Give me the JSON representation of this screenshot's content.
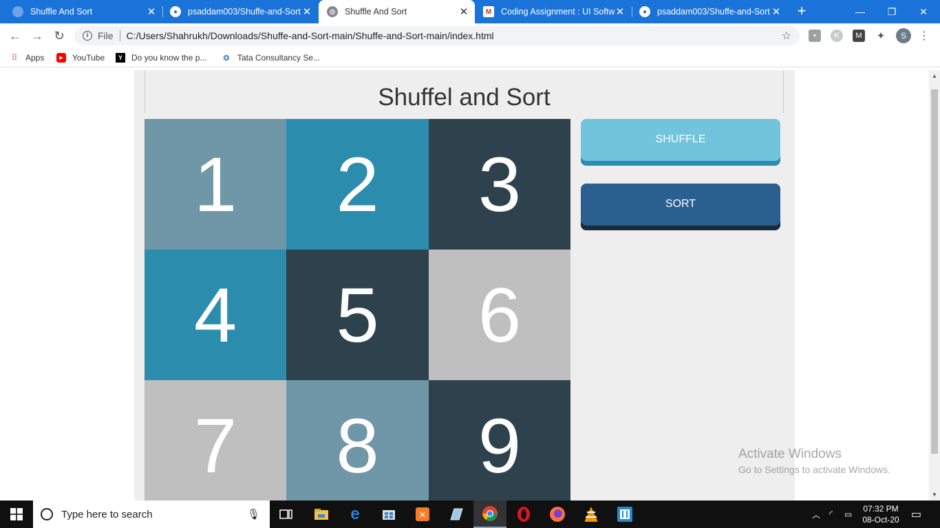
{
  "browser": {
    "tabs": [
      {
        "title": "Shuffle And Sort",
        "icon": "globe-icon",
        "active": false
      },
      {
        "title": "psaddam003/Shuffe-and-Sort",
        "icon": "github-icon",
        "active": false
      },
      {
        "title": "Shuffle And Sort",
        "icon": "globe-icon",
        "active": true
      },
      {
        "title": "Coding Assignment : UI Softwa",
        "icon": "gmail-icon",
        "active": false
      },
      {
        "title": "psaddam003/Shuffe-and-Sort",
        "icon": "github-icon",
        "active": false
      }
    ],
    "omnibox": {
      "scheme_label": "File",
      "url": "C:/Users/Shahrukh/Downloads/Shuffe-and-Sort-main/Shuffe-and-Sort-main/index.html"
    },
    "profile_initial": "S",
    "bookmarks": [
      {
        "label": "Apps",
        "icon": "apps-grid-icon"
      },
      {
        "label": "YouTube",
        "icon": "youtube-icon"
      },
      {
        "label": "Do you know the p...",
        "icon": "y-combinator-icon"
      },
      {
        "label": "Tata Consultancy Se...",
        "icon": "tata-icon"
      }
    ]
  },
  "page": {
    "title": "Shuffel and Sort",
    "tiles": [
      {
        "number": "1",
        "color": "#6f97a8"
      },
      {
        "number": "2",
        "color": "#2b8cad"
      },
      {
        "number": "3",
        "color": "#2e424d"
      },
      {
        "number": "4",
        "color": "#2b8cad"
      },
      {
        "number": "5",
        "color": "#2e424d"
      },
      {
        "number": "6",
        "color": "#bfbfbf"
      },
      {
        "number": "7",
        "color": "#bfbfbf"
      },
      {
        "number": "8",
        "color": "#6f97a8"
      },
      {
        "number": "9",
        "color": "#2e424d"
      }
    ],
    "buttons": {
      "shuffle_label": "SHUFFLE",
      "sort_label": "SORT"
    }
  },
  "watermark": {
    "line1": "Activate Windows",
    "line2": "Go to Settings to activate Windows."
  },
  "taskbar": {
    "search_placeholder": "Type here to search",
    "time": "07:32 PM",
    "date": "08-Oct-20"
  }
}
